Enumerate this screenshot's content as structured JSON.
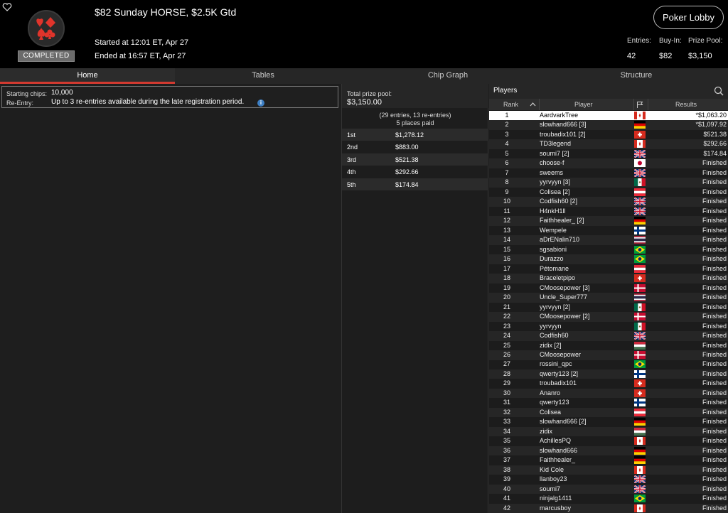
{
  "header": {
    "title": "$82 Sunday HORSE, $2.5K Gtd",
    "status_badge": "COMPLETED",
    "started": "Started at 12:01 ET, Apr 27",
    "ended": "Ended at 16:57 ET, Apr 27",
    "lobby_button": "Poker Lobby",
    "stats": [
      {
        "label": "Entries:",
        "value": "42"
      },
      {
        "label": "Buy-In:",
        "value": "$82"
      },
      {
        "label": "Prize Pool:",
        "value": "$3,150"
      }
    ]
  },
  "tabs": [
    {
      "label": "Home",
      "active": true
    },
    {
      "label": "Tables",
      "active": false
    },
    {
      "label": "Chip Graph",
      "active": false
    },
    {
      "label": "Structure",
      "active": false
    }
  ],
  "info": {
    "starting_chips_label": "Starting chips:",
    "starting_chips_value": "10,000",
    "reentry_label": "Re-Entry:",
    "reentry_value": "Up to 3 re-entries available during the late registration period.",
    "info_icon": "i"
  },
  "prize": {
    "label": "Total prize pool:",
    "amount": "$3,150.00",
    "entries_note": "(29 entries, 13 re-entries)",
    "places_note": "5 places paid",
    "places": [
      {
        "place": "1st",
        "amount": "$1,278.12"
      },
      {
        "place": "2nd",
        "amount": "$883.00"
      },
      {
        "place": "3rd",
        "amount": "$521.38"
      },
      {
        "place": "4th",
        "amount": "$292.66"
      },
      {
        "place": "5th",
        "amount": "$174.84"
      }
    ]
  },
  "players": {
    "title": "Players",
    "columns": {
      "rank": "Rank",
      "player": "Player",
      "results": "Results"
    },
    "rows": [
      {
        "rank": "1",
        "name": "AardvarkTree",
        "flag": "ca",
        "result": "*$1,063.20"
      },
      {
        "rank": "2",
        "name": "slowhand666 [3]",
        "flag": "de",
        "result": "*$1,097.92"
      },
      {
        "rank": "3",
        "name": "troubadix101 [2]",
        "flag": "ch",
        "result": "$521.38"
      },
      {
        "rank": "4",
        "name": "TD3legend",
        "flag": "ca",
        "result": "$292.66"
      },
      {
        "rank": "5",
        "name": "soumi7 [2]",
        "flag": "gb",
        "result": "$174.84"
      },
      {
        "rank": "6",
        "name": "choose-f",
        "flag": "jp",
        "result": "Finished"
      },
      {
        "rank": "7",
        "name": "sweems",
        "flag": "gb",
        "result": "Finished"
      },
      {
        "rank": "8",
        "name": "yyrvyyn [3]",
        "flag": "mx",
        "result": "Finished"
      },
      {
        "rank": "9",
        "name": "Colisea [2]",
        "flag": "at",
        "result": "Finished"
      },
      {
        "rank": "10",
        "name": "Codfish60 [2]",
        "flag": "gb",
        "result": "Finished"
      },
      {
        "rank": "11",
        "name": "H4nkH1ll",
        "flag": "gb",
        "result": "Finished"
      },
      {
        "rank": "12",
        "name": "Faithhealer_ [2]",
        "flag": "de",
        "result": "Finished"
      },
      {
        "rank": "13",
        "name": "Wempele",
        "flag": "fi",
        "result": "Finished"
      },
      {
        "rank": "14",
        "name": "aDrENalin710",
        "flag": "th",
        "result": "Finished"
      },
      {
        "rank": "15",
        "name": "sgsabioni",
        "flag": "br",
        "result": "Finished"
      },
      {
        "rank": "16",
        "name": "Durazzo",
        "flag": "br",
        "result": "Finished"
      },
      {
        "rank": "17",
        "name": "Pétomane",
        "flag": "at",
        "result": "Finished"
      },
      {
        "rank": "18",
        "name": "Braceletpipo",
        "flag": "ch",
        "result": "Finished"
      },
      {
        "rank": "19",
        "name": "CMoosepower [3]",
        "flag": "dk",
        "result": "Finished"
      },
      {
        "rank": "20",
        "name": "Uncle_Super777",
        "flag": "th",
        "result": "Finished"
      },
      {
        "rank": "21",
        "name": "yyrvyyn [2]",
        "flag": "mx",
        "result": "Finished"
      },
      {
        "rank": "22",
        "name": "CMoosepower [2]",
        "flag": "dk",
        "result": "Finished"
      },
      {
        "rank": "23",
        "name": "yyrvyyn",
        "flag": "mx",
        "result": "Finished"
      },
      {
        "rank": "24",
        "name": "Codfish60",
        "flag": "gb",
        "result": "Finished"
      },
      {
        "rank": "25",
        "name": "zidix [2]",
        "flag": "hu",
        "result": "Finished"
      },
      {
        "rank": "26",
        "name": "CMoosepower",
        "flag": "dk",
        "result": "Finished"
      },
      {
        "rank": "27",
        "name": "rossini_qpc",
        "flag": "br",
        "result": "Finished"
      },
      {
        "rank": "28",
        "name": "qwerty123 [2]",
        "flag": "fi",
        "result": "Finished"
      },
      {
        "rank": "29",
        "name": "troubadix101",
        "flag": "ch",
        "result": "Finished"
      },
      {
        "rank": "30",
        "name": "Ananro",
        "flag": "ch",
        "result": "Finished"
      },
      {
        "rank": "31",
        "name": "qwerty123",
        "flag": "fi",
        "result": "Finished"
      },
      {
        "rank": "32",
        "name": "Colisea",
        "flag": "at",
        "result": "Finished"
      },
      {
        "rank": "33",
        "name": "slowhand666 [2]",
        "flag": "de",
        "result": "Finished"
      },
      {
        "rank": "34",
        "name": "zidix",
        "flag": "hu",
        "result": "Finished"
      },
      {
        "rank": "35",
        "name": "AchillesPQ",
        "flag": "ca",
        "result": "Finished"
      },
      {
        "rank": "36",
        "name": "slowhand666",
        "flag": "de",
        "result": "Finished"
      },
      {
        "rank": "37",
        "name": "Faithhealer_",
        "flag": "de",
        "result": "Finished"
      },
      {
        "rank": "38",
        "name": "Kid Cole",
        "flag": "ca",
        "result": "Finished"
      },
      {
        "rank": "39",
        "name": "llanboy23",
        "flag": "gb",
        "result": "Finished"
      },
      {
        "rank": "40",
        "name": "soumi7",
        "flag": "gb",
        "result": "Finished"
      },
      {
        "rank": "41",
        "name": "ninjalg1411",
        "flag": "br",
        "result": "Finished"
      },
      {
        "rank": "42",
        "name": "marcusboy",
        "flag": "ca",
        "result": "Finished"
      }
    ]
  }
}
